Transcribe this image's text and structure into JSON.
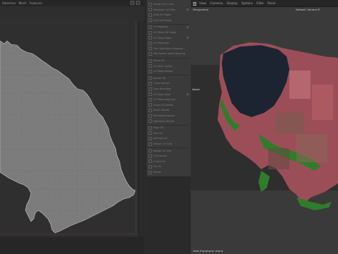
{
  "left_menubar": {
    "items": [
      "Selection",
      "Mesh",
      "Features"
    ]
  },
  "project_select": {
    "value": "Project"
  },
  "menu": {
    "items": [
      "Sculpt Grid Lines",
      "Navigate Cell Elev",
      "Grab All Edges",
      "Flip Grid Edges",
      "UV Mapping",
      "UV Mirror All Edges",
      "UV Snap Edges",
      "UV Projection",
      "Calc Split Alpha Mapping",
      "Edit Raster Alpha Mapping",
      "Mirror UV",
      "UV Shell Layout",
      "UV Reset Border",
      "Border UV",
      "Orient Border",
      "Lock Boundary",
      "UV Separation",
      "UV Relax Mapping",
      "Scale UV Islands",
      "Stack Islands",
      "Normalize Islands",
      "Distribute Islands",
      "Align UV",
      "Sort UV",
      "Average UV",
      "Stretch UV Grid",
      "Rotate UV Grid",
      "Flip Islands",
      "Unfold UV",
      "Pin UV",
      "Merge"
    ]
  },
  "viewport": {
    "menubar": [
      "View",
      "Cameras",
      "Display",
      "Options",
      "Filter",
      "Panel"
    ],
    "mode_label": "Perspective",
    "camera_label": "Default Camera",
    "side_label": "Above",
    "status_text": "View Transforms: Scene"
  },
  "colors": {
    "uv_fill": "#7a7a7a",
    "uv_grid": "#9a9a9a",
    "bg_dark": "#2b2b2b",
    "menu_bg": "#3a3a3a",
    "terrain_urban": "#b9606a",
    "terrain_green": "#2f7d2a",
    "water": "#1b2430"
  },
  "icons": [
    "menu-icon",
    "camera-icon",
    "checkbox-icon"
  ]
}
